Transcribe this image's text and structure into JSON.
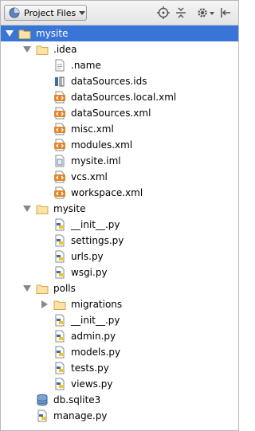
{
  "toolbar": {
    "view_label": "Project Files",
    "view_icon": "project-files-icon",
    "icons": [
      "target-locate-icon",
      "collapse-all-icon",
      "gear-icon",
      "hide-panel-icon"
    ]
  },
  "colors": {
    "selection": "#3875d7",
    "folder": "#d9a74a",
    "python_blue": "#3c6ea5",
    "python_yellow": "#f5c518",
    "xml_orange": "#e0862a"
  },
  "tree": [
    {
      "label": "mysite",
      "depth": 0,
      "icon": "folder-icon",
      "expander": "down",
      "selected": true
    },
    {
      "label": ".idea",
      "depth": 1,
      "icon": "folder-icon",
      "expander": "down"
    },
    {
      "label": ".name",
      "depth": 2,
      "icon": "text-file-icon"
    },
    {
      "label": "dataSources.ids",
      "depth": 2,
      "icon": "ids-file-icon"
    },
    {
      "label": "dataSources.local.xml",
      "depth": 2,
      "icon": "xml-file-icon"
    },
    {
      "label": "dataSources.xml",
      "depth": 2,
      "icon": "xml-file-icon"
    },
    {
      "label": "misc.xml",
      "depth": 2,
      "icon": "xml-file-icon"
    },
    {
      "label": "modules.xml",
      "depth": 2,
      "icon": "xml-file-icon"
    },
    {
      "label": "mysite.iml",
      "depth": 2,
      "icon": "iml-file-icon"
    },
    {
      "label": "vcs.xml",
      "depth": 2,
      "icon": "xml-file-icon"
    },
    {
      "label": "workspace.xml",
      "depth": 2,
      "icon": "xml-file-icon"
    },
    {
      "label": "mysite",
      "depth": 1,
      "icon": "folder-icon",
      "expander": "down"
    },
    {
      "label": "__init__.py",
      "depth": 2,
      "icon": "python-file-icon"
    },
    {
      "label": "settings.py",
      "depth": 2,
      "icon": "python-file-icon"
    },
    {
      "label": "urls.py",
      "depth": 2,
      "icon": "python-file-icon"
    },
    {
      "label": "wsgi.py",
      "depth": 2,
      "icon": "python-file-icon"
    },
    {
      "label": "polls",
      "depth": 1,
      "icon": "folder-icon",
      "expander": "down"
    },
    {
      "label": "migrations",
      "depth": 2,
      "icon": "folder-icon",
      "expander": "right"
    },
    {
      "label": "__init__.py",
      "depth": 2,
      "icon": "python-file-icon"
    },
    {
      "label": "admin.py",
      "depth": 2,
      "icon": "python-file-icon"
    },
    {
      "label": "models.py",
      "depth": 2,
      "icon": "python-file-icon"
    },
    {
      "label": "tests.py",
      "depth": 2,
      "icon": "python-file-icon"
    },
    {
      "label": "views.py",
      "depth": 2,
      "icon": "python-file-icon"
    },
    {
      "label": "db.sqlite3",
      "depth": 1,
      "icon": "database-file-icon"
    },
    {
      "label": "manage.py",
      "depth": 1,
      "icon": "python-file-icon"
    }
  ]
}
